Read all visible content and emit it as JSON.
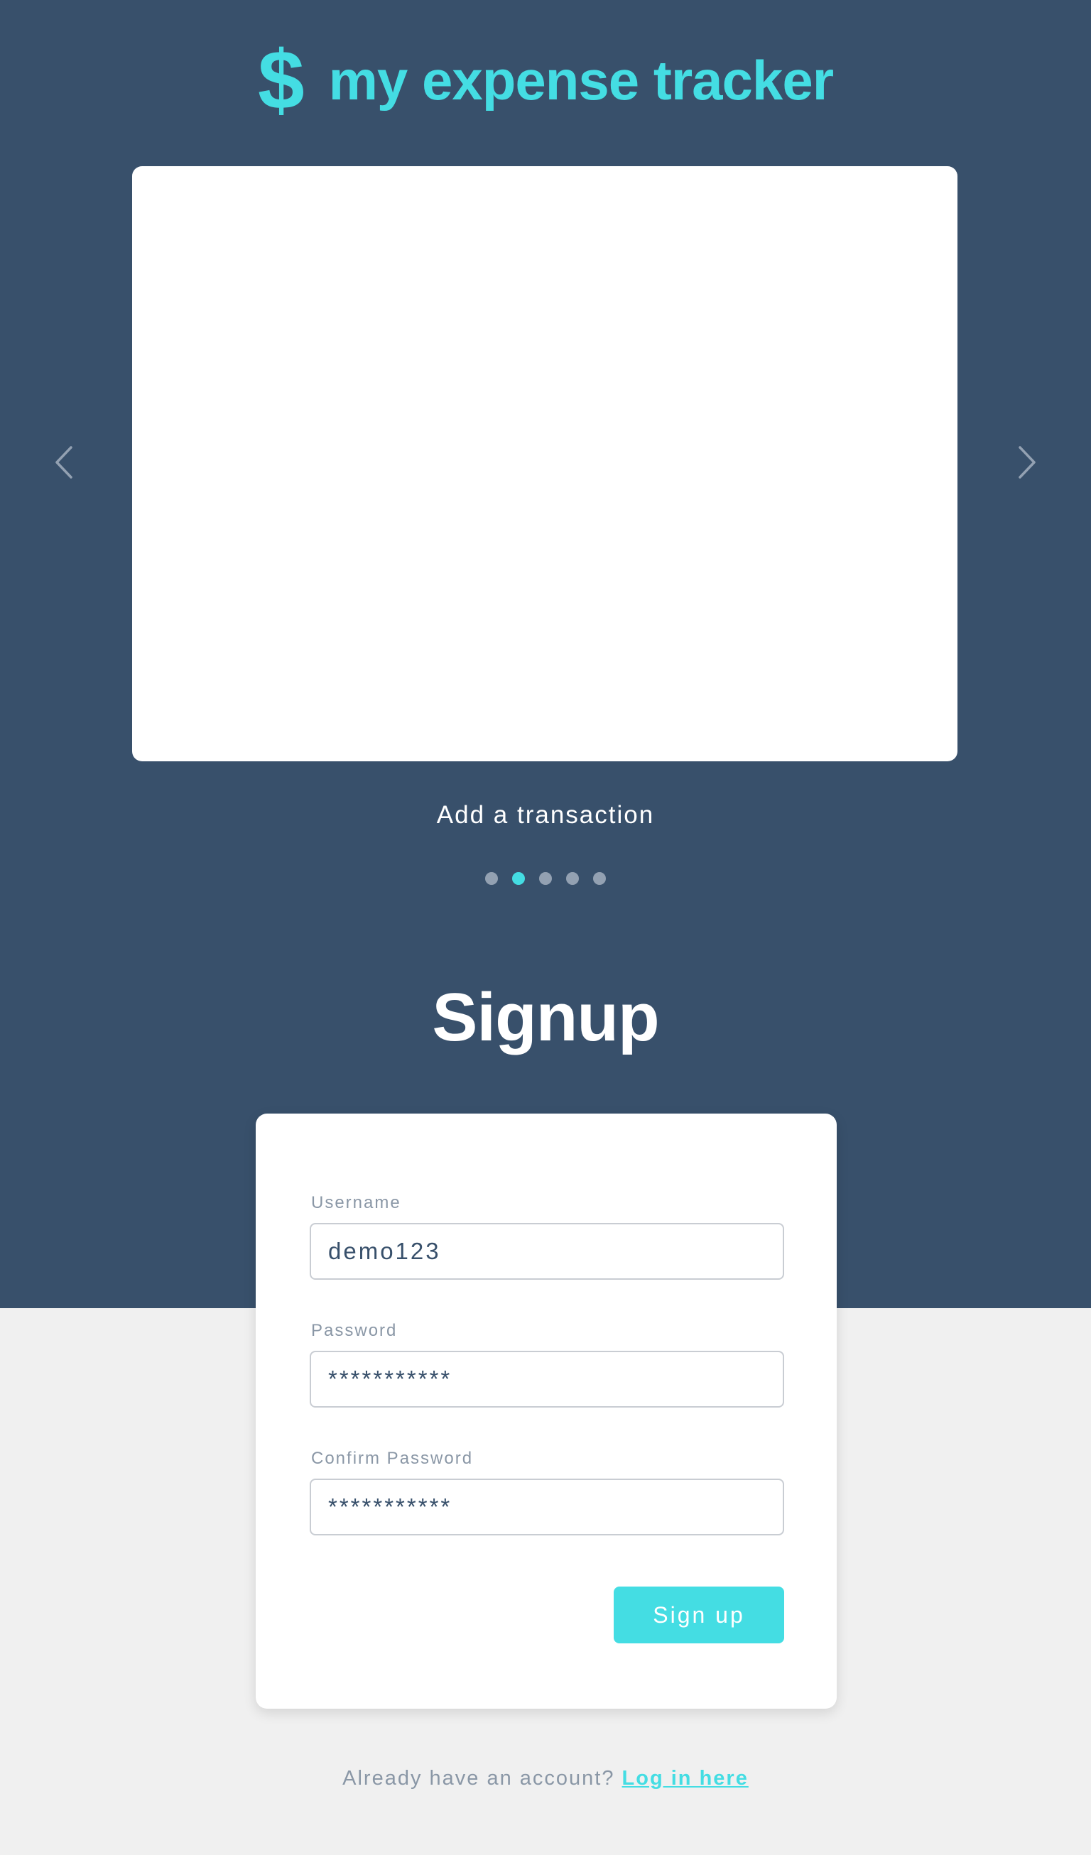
{
  "brand": {
    "icon": "$",
    "title": "my expense tracker",
    "accent_color": "#44dde3"
  },
  "carousel": {
    "caption": "Add a transaction",
    "prev_icon": "chevron-left-icon",
    "next_icon": "chevron-right-icon",
    "dot_count": 5,
    "active_index": 1
  },
  "signup": {
    "title": "Signup",
    "fields": [
      {
        "label": "Username",
        "value": "demo123"
      },
      {
        "label": "Password",
        "value": "***********"
      },
      {
        "label": "Confirm Password",
        "value": "***********"
      }
    ],
    "button_label": "Sign up"
  },
  "login": {
    "prompt": "Already have an account? ",
    "link_label": "Log in here"
  },
  "colors": {
    "hero_background": "#38506b",
    "page_background": "#f0f0f0",
    "accent": "#44dde3",
    "muted_text": "#8a97a6"
  }
}
